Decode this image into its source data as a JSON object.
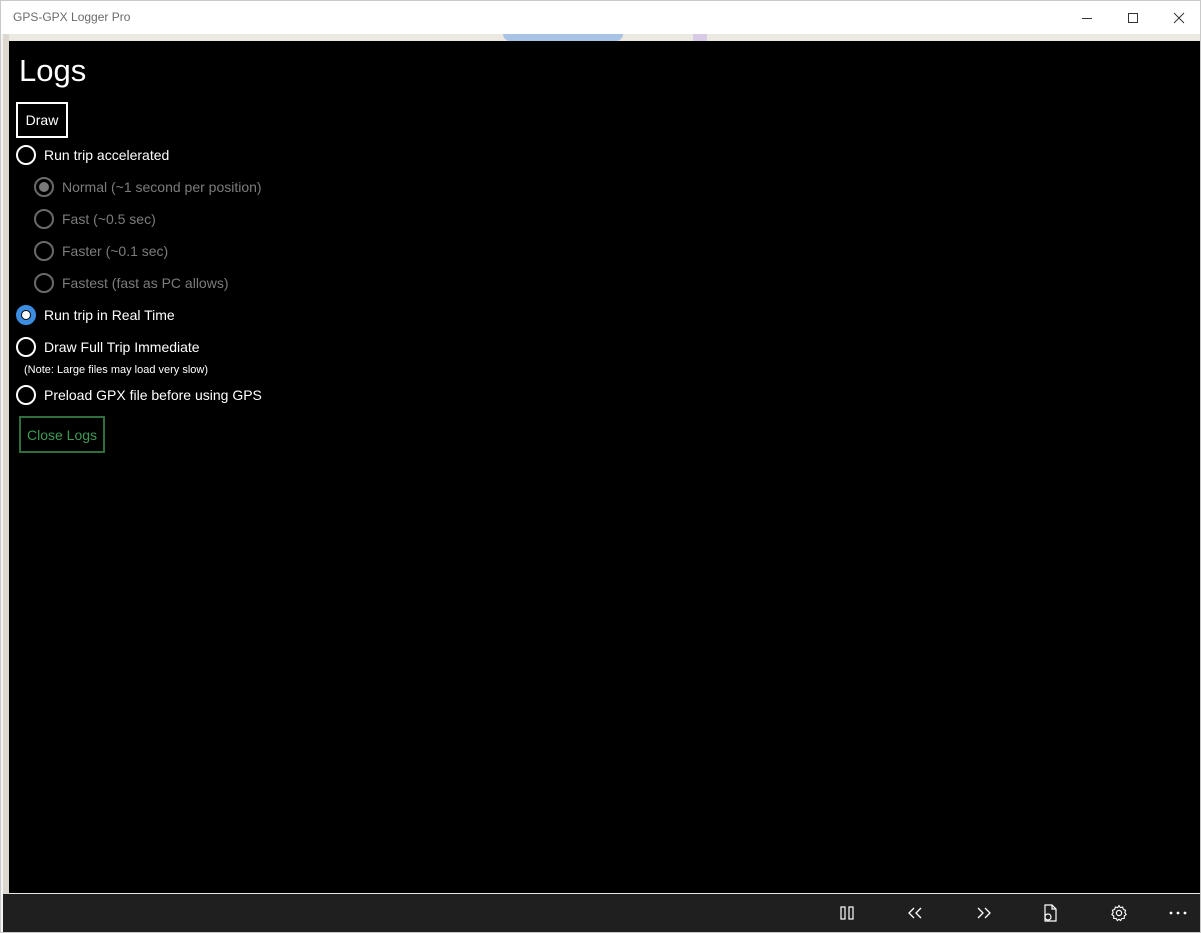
{
  "window": {
    "title": "GPS-GPX Logger Pro"
  },
  "panel": {
    "heading": "Logs",
    "draw_button": "Draw",
    "options": [
      {
        "label": "Run trip accelerated",
        "checked": false,
        "enabled": true
      },
      {
        "label": "Normal (~1 second per position)",
        "checked": true,
        "enabled": false
      },
      {
        "label": "Fast (~0.5 sec)",
        "checked": false,
        "enabled": false
      },
      {
        "label": "Faster (~0.1 sec)",
        "checked": false,
        "enabled": false
      },
      {
        "label": "Fastest (fast as PC allows)",
        "checked": false,
        "enabled": false
      },
      {
        "label": "Run trip in Real Time",
        "checked": true,
        "enabled": true
      },
      {
        "label": "Draw Full Trip Immediate",
        "checked": false,
        "enabled": true
      },
      {
        "label": "Preload GPX file before using GPS",
        "checked": false,
        "enabled": true
      }
    ],
    "note": "(Note: Large files may load very slow)",
    "close_button": "Close Logs"
  },
  "appbar": {
    "buttons": [
      "pause-icon",
      "rewind-icon",
      "fast-forward-icon",
      "file-icon",
      "settings-icon",
      "more-icon"
    ]
  },
  "colors": {
    "panel_bg": "#000000",
    "accent": "#3a8de0",
    "close_button_border": "#2e6f3e",
    "close_button_text": "#3f9a55",
    "appbar_bg": "#1f1f1f"
  }
}
